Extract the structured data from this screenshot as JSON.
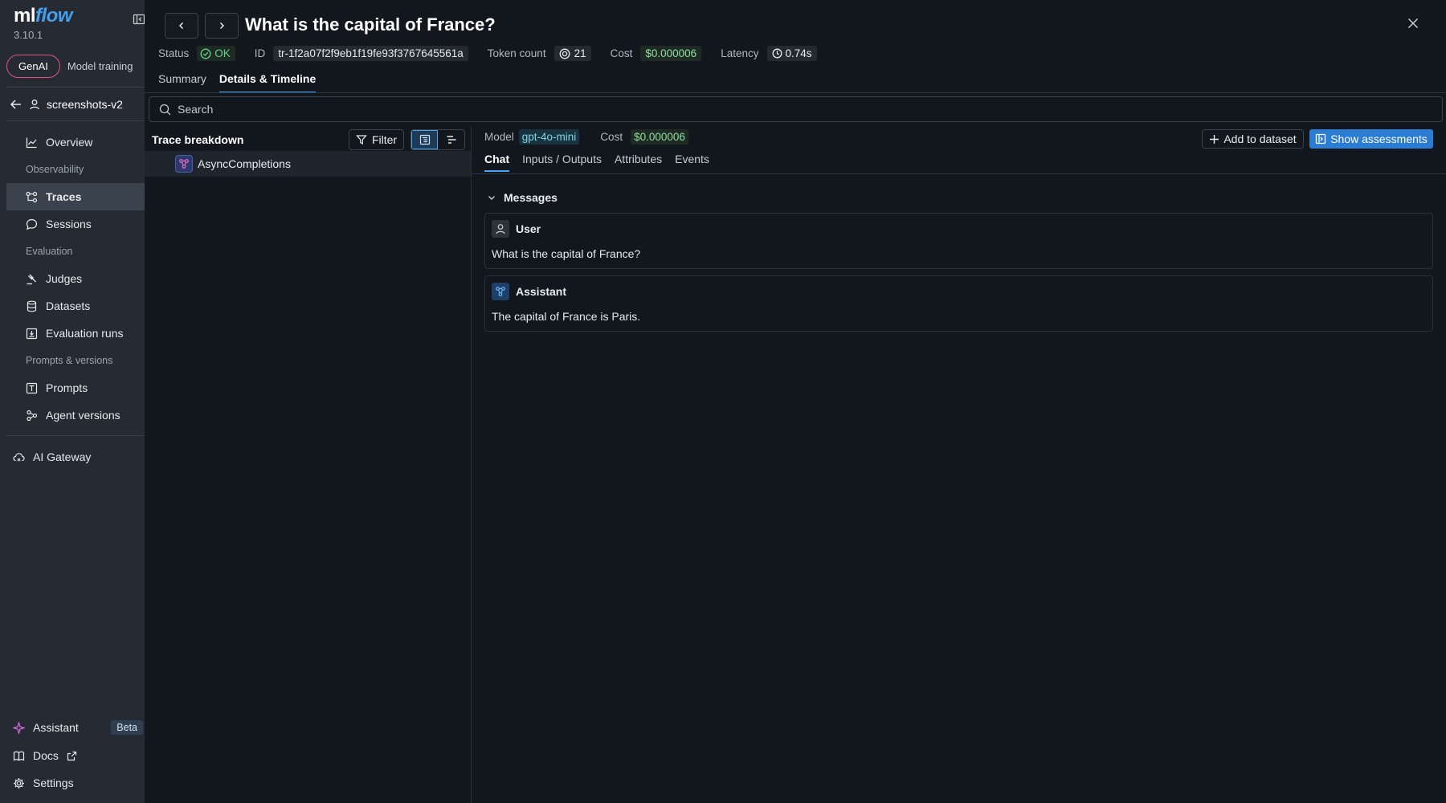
{
  "app": {
    "logo_ml": "ml",
    "logo_flow": "flow",
    "version": "3.10.1"
  },
  "sidebar": {
    "mode_tabs": [
      "GenAI",
      "Model training"
    ],
    "experiment": "screenshots-v2",
    "items": [
      {
        "label": "Overview"
      },
      {
        "section": "Observability"
      },
      {
        "label": "Traces",
        "active": true
      },
      {
        "label": "Sessions"
      },
      {
        "section": "Evaluation"
      },
      {
        "label": "Judges"
      },
      {
        "label": "Datasets"
      },
      {
        "label": "Evaluation runs"
      },
      {
        "section": "Prompts & versions"
      },
      {
        "label": "Prompts"
      },
      {
        "label": "Agent versions"
      }
    ],
    "gateway": "AI Gateway",
    "assistant": "Assistant",
    "beta": "Beta",
    "docs": "Docs",
    "settings": "Settings"
  },
  "trace": {
    "title": "What is the capital of France?",
    "status_label": "Status",
    "status": "OK",
    "id_label": "ID",
    "id": "tr-1f2a07f2f9eb1f19fe93f3767645561a",
    "token_label": "Token count",
    "tokens": "21",
    "cost_label": "Cost",
    "cost": "$0.000006",
    "latency_label": "Latency",
    "latency": "0.74s",
    "tabs": [
      "Summary",
      "Details & Timeline"
    ],
    "active_tab": "Details & Timeline"
  },
  "search": {
    "placeholder": "Search"
  },
  "breakdown": {
    "title": "Trace breakdown",
    "filter": "Filter",
    "span": "AsyncCompletions"
  },
  "detail": {
    "model_label": "Model",
    "model": "gpt-4o-mini",
    "cost_label": "Cost",
    "cost": "$0.000006",
    "add_dataset": "Add to dataset",
    "show_assessments": "Show assessments",
    "tabs": [
      "Chat",
      "Inputs / Outputs",
      "Attributes",
      "Events"
    ],
    "messages_label": "Messages",
    "messages": [
      {
        "role": "User",
        "text": "What is the capital of France?"
      },
      {
        "role": "Assistant",
        "text": "The capital of France is Paris."
      }
    ]
  },
  "colors": {
    "accent": "#2b7cd3",
    "ok_green": "#5fd488",
    "genai_border": "#e05575"
  }
}
